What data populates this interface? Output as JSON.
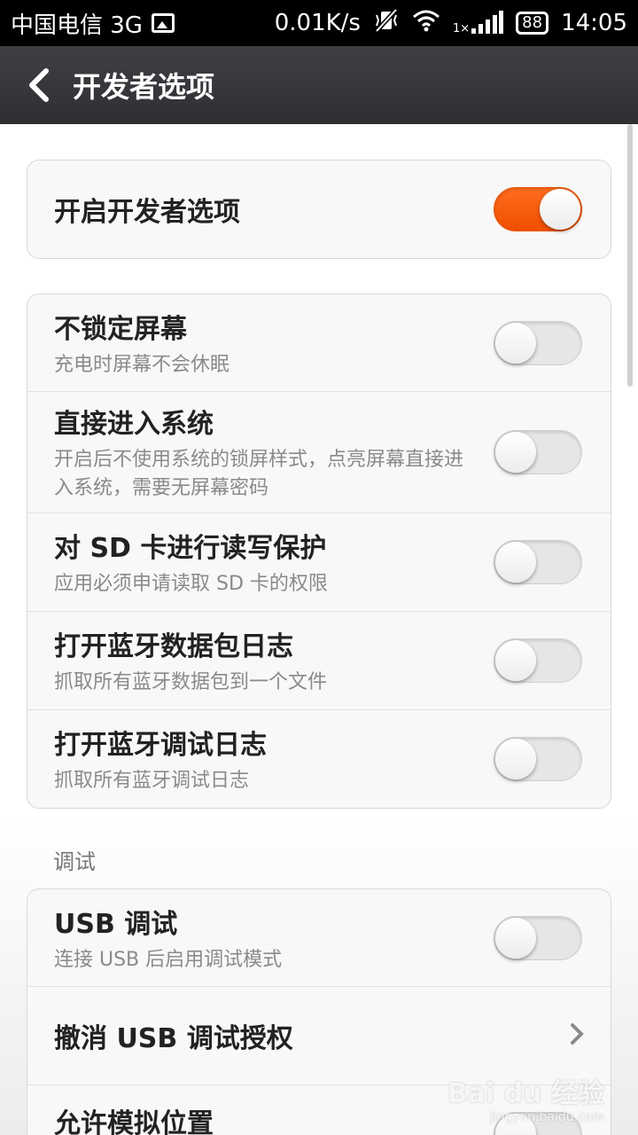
{
  "status_bar": {
    "carrier": "中国电信 3G",
    "speed": "0.01K/s",
    "signal_label": "1×",
    "battery": "88",
    "time": "14:05"
  },
  "header": {
    "title": "开发者选项"
  },
  "main": {
    "master_toggle": {
      "label": "开启开发者选项",
      "on": true
    },
    "group1": [
      {
        "title": "不锁定屏幕",
        "subtitle": "充电时屏幕不会休眠",
        "on": false
      },
      {
        "title": "直接进入系统",
        "subtitle": "开启后不使用系统的锁屏样式，点亮屏幕直接进入系统，需要无屏幕密码",
        "on": false
      },
      {
        "title": "对 SD 卡进行读写保护",
        "subtitle": "应用必须申请读取 SD 卡的权限",
        "on": false
      },
      {
        "title": "打开蓝牙数据包日志",
        "subtitle": "抓取所有蓝牙数据包到一个文件",
        "on": false
      },
      {
        "title": "打开蓝牙调试日志",
        "subtitle": "抓取所有蓝牙调试日志",
        "on": false
      }
    ],
    "debug_section_label": "调试",
    "debug_group": [
      {
        "title": "USB 调试",
        "subtitle": "连接 USB 后启用调试模式",
        "on": false
      },
      {
        "title": "撤消 USB 调试授权"
      },
      {
        "title": "允许模拟位置"
      }
    ]
  },
  "watermark": {
    "text": "Bai du 经验",
    "url": "jingyan.baidu.com"
  },
  "colors": {
    "accent": "#f45a0a",
    "titlebar": "#34363a"
  }
}
